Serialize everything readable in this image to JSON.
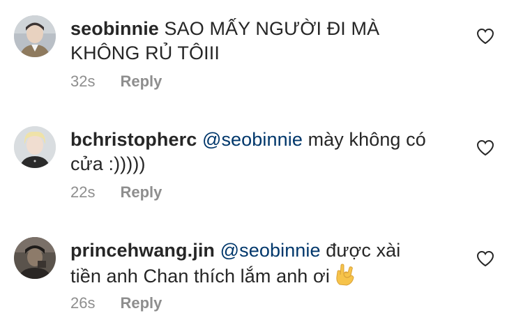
{
  "comments": [
    {
      "username": "seobinnie",
      "mention": "",
      "text": "SAO MẤY NGƯỜI ĐI MÀ KHÔNG RỦ TÔIII",
      "time": "32s",
      "reply_label": "Reply",
      "avatar_icon": "profile-photo"
    },
    {
      "username": "bchristopherc",
      "mention": "@seobinnie",
      "text": "mày không có cửa :)))))",
      "time": "22s",
      "reply_label": "Reply",
      "avatar_icon": "profile-photo"
    },
    {
      "username": "princehwang.jin",
      "mention": "@seobinnie",
      "text": "được xài tiền anh Chan thích lắm anh ơi",
      "emoji": "🤟",
      "time": "26s",
      "reply_label": "Reply",
      "avatar_icon": "profile-photo"
    }
  ],
  "icons": {
    "like": "heart-outline-icon"
  },
  "colors": {
    "text": "#262626",
    "mention": "#00376b",
    "meta": "#8e8e8e",
    "background": "#ffffff"
  }
}
